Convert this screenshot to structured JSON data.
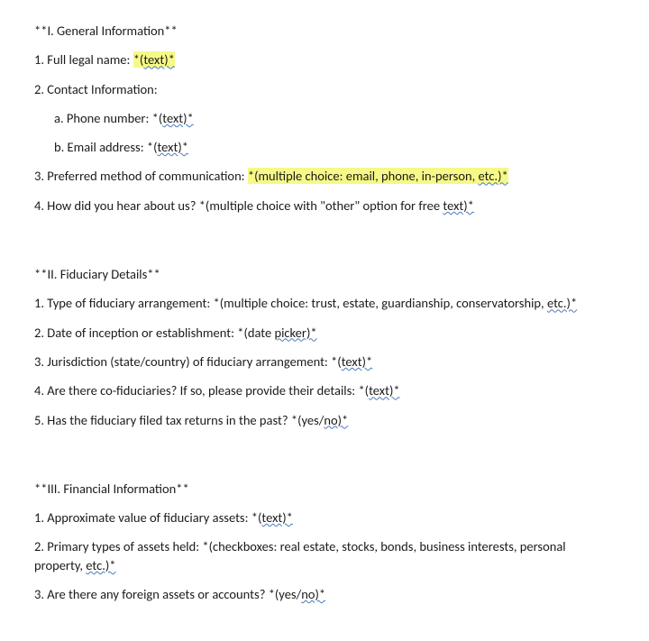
{
  "sections": [
    {
      "heading": "**I. General Information**",
      "items": [
        {
          "num": "1.",
          "text_before": " Full legal name: ",
          "hl_before": "*(",
          "hl_squiggle": "text)*",
          "hl_after": "",
          "trailing": ""
        },
        {
          "num": "2.",
          "text_before": " Contact Information:",
          "subs": [
            {
              "label": "a.",
              "plain": " Phone number: *(",
              "squiggle": "text)*"
            },
            {
              "label": "b.",
              "plain": " Email address: *(",
              "squiggle": "text)*"
            }
          ]
        },
        {
          "num": "3.",
          "text_before": " Preferred method of communication: ",
          "hl_before": "*(multiple choice: email, phone, in-person, ",
          "hl_squiggle": "etc.)*",
          "hl_after": "",
          "trailing": ""
        },
        {
          "num": "4.",
          "text_before": " How did you hear about us? *(multiple choice with \"other\" option for free ",
          "squiggle": "text)*"
        }
      ]
    },
    {
      "heading": "**II. Fiduciary Details**",
      "items": [
        {
          "num": "1.",
          "text_before": " Type of fiduciary arrangement: *(multiple choice: trust, estate, guardianship, conservatorship, ",
          "squiggle": "etc.)*"
        },
        {
          "num": "2.",
          "text_before": " Date of inception or establishment: *(date ",
          "squiggle": "picker)*"
        },
        {
          "num": "3.",
          "text_before": " Jurisdiction (state/country) of fiduciary arrangement: *(",
          "squiggle": "text)*"
        },
        {
          "num": "4.",
          "text_before": " Are there co-fiduciaries? If so, please provide their details: *(",
          "squiggle": "text)*"
        },
        {
          "num": "5.",
          "text_before": " Has the fiduciary filed tax returns in the past? *(yes/",
          "squiggle": "no)*"
        }
      ]
    },
    {
      "heading": "**III. Financial Information**",
      "items": [
        {
          "num": "1.",
          "text_before": " Approximate value of fiduciary assets: *(",
          "squiggle": "text)*"
        },
        {
          "num": "2.",
          "text_before": " Primary types of assets held: *(checkboxes: real estate, stocks, bonds, business interests, personal property, ",
          "squiggle": "etc.)*"
        },
        {
          "num": "3.",
          "text_before": " Are there any foreign assets or accounts? *(yes/",
          "squiggle": "no)*"
        }
      ]
    }
  ]
}
